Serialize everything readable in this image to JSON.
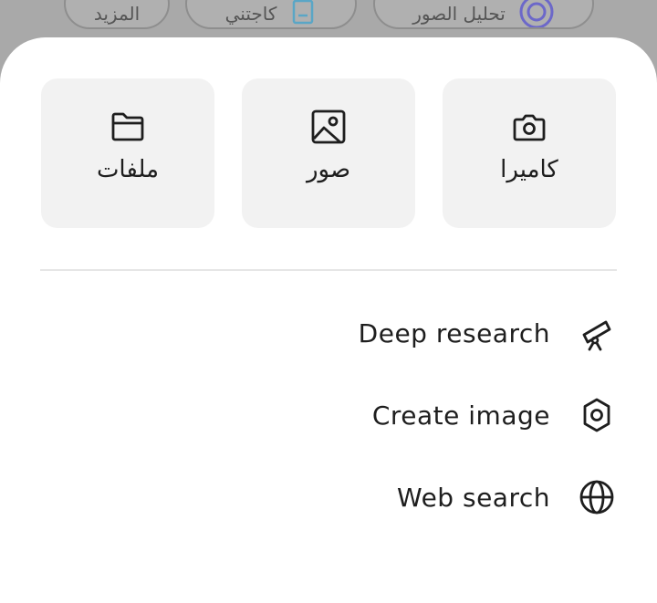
{
  "background_chips": [
    {
      "label": "تحليل الصور",
      "icon": "image-analysis-icon"
    },
    {
      "label": "كاجتني",
      "icon": "document-icon"
    },
    {
      "label": "المزيد",
      "icon": ""
    }
  ],
  "attach": {
    "camera_label": "كاميرا",
    "photos_label": "صور",
    "files_label": "ملفات"
  },
  "menu": {
    "deep_research": "Deep research",
    "create_image": "Create image",
    "web_search": "Web search"
  },
  "colors": {
    "sheet": "#ffffff",
    "tile": "#f2f2f2",
    "text": "#1e1e1e",
    "scrim": "#a9a9a9"
  }
}
